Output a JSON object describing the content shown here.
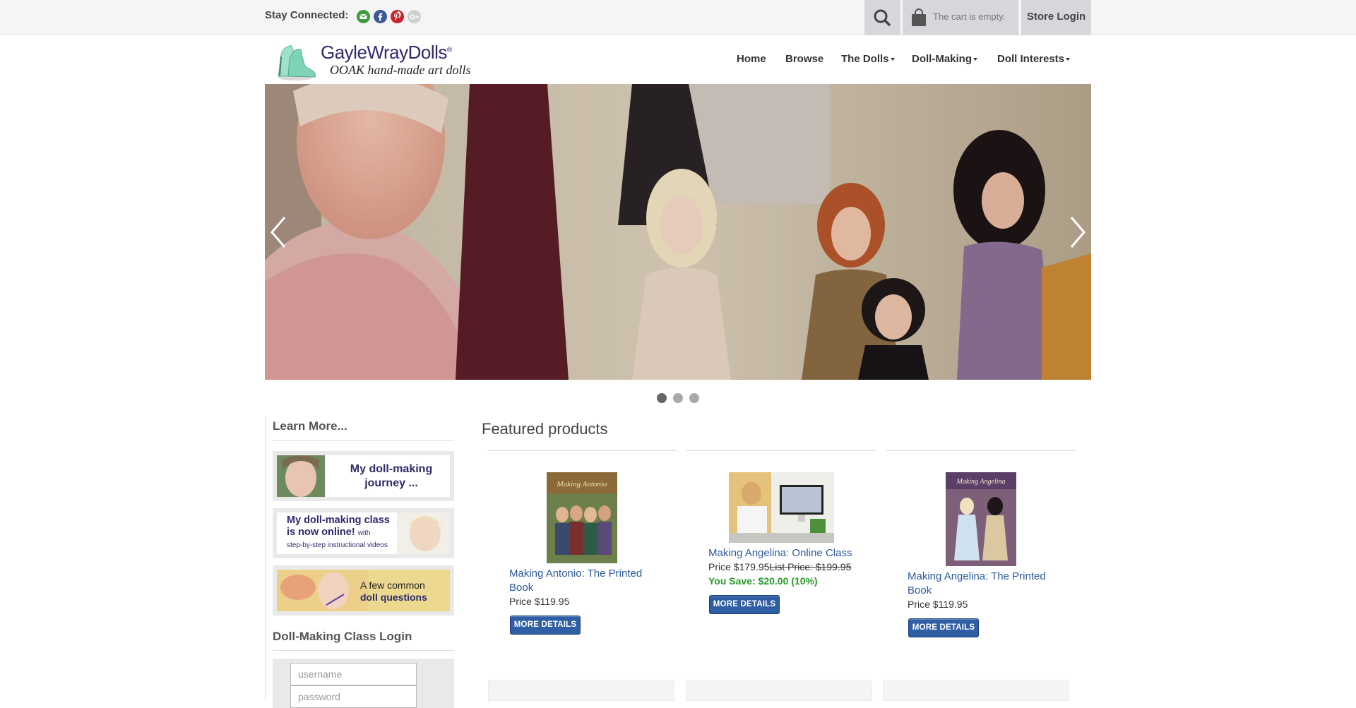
{
  "topbar": {
    "stay_connected": "Stay Connected:",
    "social_icons": [
      "email-icon",
      "facebook-icon",
      "pinterest-icon",
      "google-plus-icon"
    ],
    "cart_text": "The cart is empty.",
    "store_login": "Store Login"
  },
  "logo": {
    "name": "GayleWrayDolls",
    "reg": "®",
    "tagline": "OOAK hand-made art dolls"
  },
  "nav": {
    "items": [
      {
        "label": "Home",
        "dropdown": false
      },
      {
        "label": "Browse",
        "dropdown": false
      },
      {
        "label": "The Dolls",
        "dropdown": true
      },
      {
        "label": "Doll-Making",
        "dropdown": true
      },
      {
        "label": "Doll Interests",
        "dropdown": true
      }
    ]
  },
  "slider": {
    "slide_count": 3,
    "active_slide": 1
  },
  "sidebar": {
    "learn_heading": "Learn More...",
    "tiles": [
      {
        "line1": "My doll-making",
        "line2": "journey ..."
      },
      {
        "line1": "My doll-making class",
        "line2": "is now online!",
        "line2_small": "with",
        "line3": "step-by-step instructional videos"
      },
      {
        "line1": "A few common",
        "line2": "doll questions"
      }
    ],
    "login_heading": "Doll-Making Class Login",
    "username_placeholder": "username",
    "password_placeholder": "password"
  },
  "featured": {
    "title": "Featured products",
    "button_label": "MORE DETAILS",
    "products": [
      {
        "name_line1": "Making Antonio: The Printed",
        "name_line2": "Book",
        "price": "Price $119.95"
      },
      {
        "name_line1": "Making Angelina: Online Class",
        "price": "Price $179.95",
        "list_price": "List Price: $199.95",
        "you_save": "You Save: $20.00 (10%)"
      },
      {
        "name_line1": "Making Angelina: The Printed",
        "name_line2": "Book",
        "price": "Price $119.95"
      }
    ]
  },
  "colors": {
    "link": "#2c5a9a",
    "button": "#2f5ea5",
    "save_green": "#2a9a2a",
    "topbar": "#f5f5f5",
    "topbar_buttons": "#d5d7db"
  }
}
